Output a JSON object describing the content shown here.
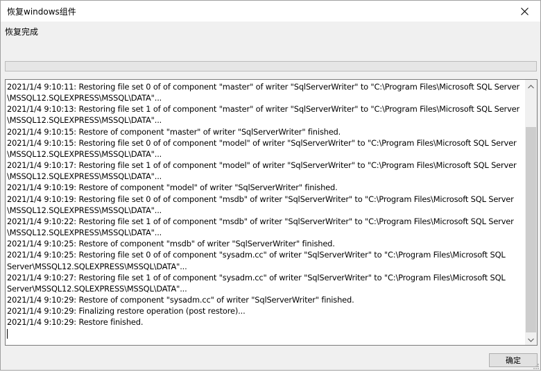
{
  "window": {
    "title": "恢复windows组件",
    "close_icon": "close-icon"
  },
  "status": {
    "label": "恢复完成",
    "progress_percent": 0
  },
  "log": {
    "lines": [
      "2021/1/4 9:10:11: Restoring file set 0 of of component \"master\" of writer \"SqlServerWriter\" to \"C:\\Program Files\\Microsoft SQL Server",
      "\\MSSQL12.SQLEXPRESS\\MSSQL\\DATA\"...",
      "2021/1/4 9:10:13: Restoring file set 1 of of component \"master\" of writer \"SqlServerWriter\" to \"C:\\Program Files\\Microsoft SQL Server",
      "\\MSSQL12.SQLEXPRESS\\MSSQL\\DATA\"...",
      "2021/1/4 9:10:15: Restore of component \"master\" of writer \"SqlServerWriter\" finished.",
      "2021/1/4 9:10:15: Restoring file set 0 of of component \"model\" of writer \"SqlServerWriter\" to \"C:\\Program Files\\Microsoft SQL Server",
      "\\MSSQL12.SQLEXPRESS\\MSSQL\\DATA\"...",
      "2021/1/4 9:10:17: Restoring file set 1 of of component \"model\" of writer \"SqlServerWriter\" to \"C:\\Program Files\\Microsoft SQL Server",
      "\\MSSQL12.SQLEXPRESS\\MSSQL\\DATA\"...",
      "2021/1/4 9:10:19: Restore of component \"model\" of writer \"SqlServerWriter\" finished.",
      "2021/1/4 9:10:19: Restoring file set 0 of of component \"msdb\" of writer \"SqlServerWriter\" to \"C:\\Program Files\\Microsoft SQL Server",
      "\\MSSQL12.SQLEXPRESS\\MSSQL\\DATA\"...",
      "2021/1/4 9:10:22: Restoring file set 1 of of component \"msdb\" of writer \"SqlServerWriter\" to \"C:\\Program Files\\Microsoft SQL Server",
      "\\MSSQL12.SQLEXPRESS\\MSSQL\\DATA\"...",
      "2021/1/4 9:10:25: Restore of component \"msdb\" of writer \"SqlServerWriter\" finished.",
      "2021/1/4 9:10:25: Restoring file set 0 of of component \"sysadm.cc\" of writer \"SqlServerWriter\" to \"C:\\Program Files\\Microsoft SQL",
      "Server\\MSSQL12.SQLEXPRESS\\MSSQL\\DATA\"...",
      "2021/1/4 9:10:27: Restoring file set 1 of of component \"sysadm.cc\" of writer \"SqlServerWriter\" to \"C:\\Program Files\\Microsoft SQL",
      "Server\\MSSQL12.SQLEXPRESS\\MSSQL\\DATA\"...",
      "2021/1/4 9:10:29: Restore of component \"sysadm.cc\" of writer \"SqlServerWriter\" finished.",
      "2021/1/4 9:10:29: Finalizing restore operation (post restore)...",
      "2021/1/4 9:10:29: Restore finished."
    ]
  },
  "scrollbar": {
    "up_icon": "scroll-up-arrow-icon",
    "down_icon": "scroll-down-arrow-icon"
  },
  "footer": {
    "ok_label": "确定"
  }
}
